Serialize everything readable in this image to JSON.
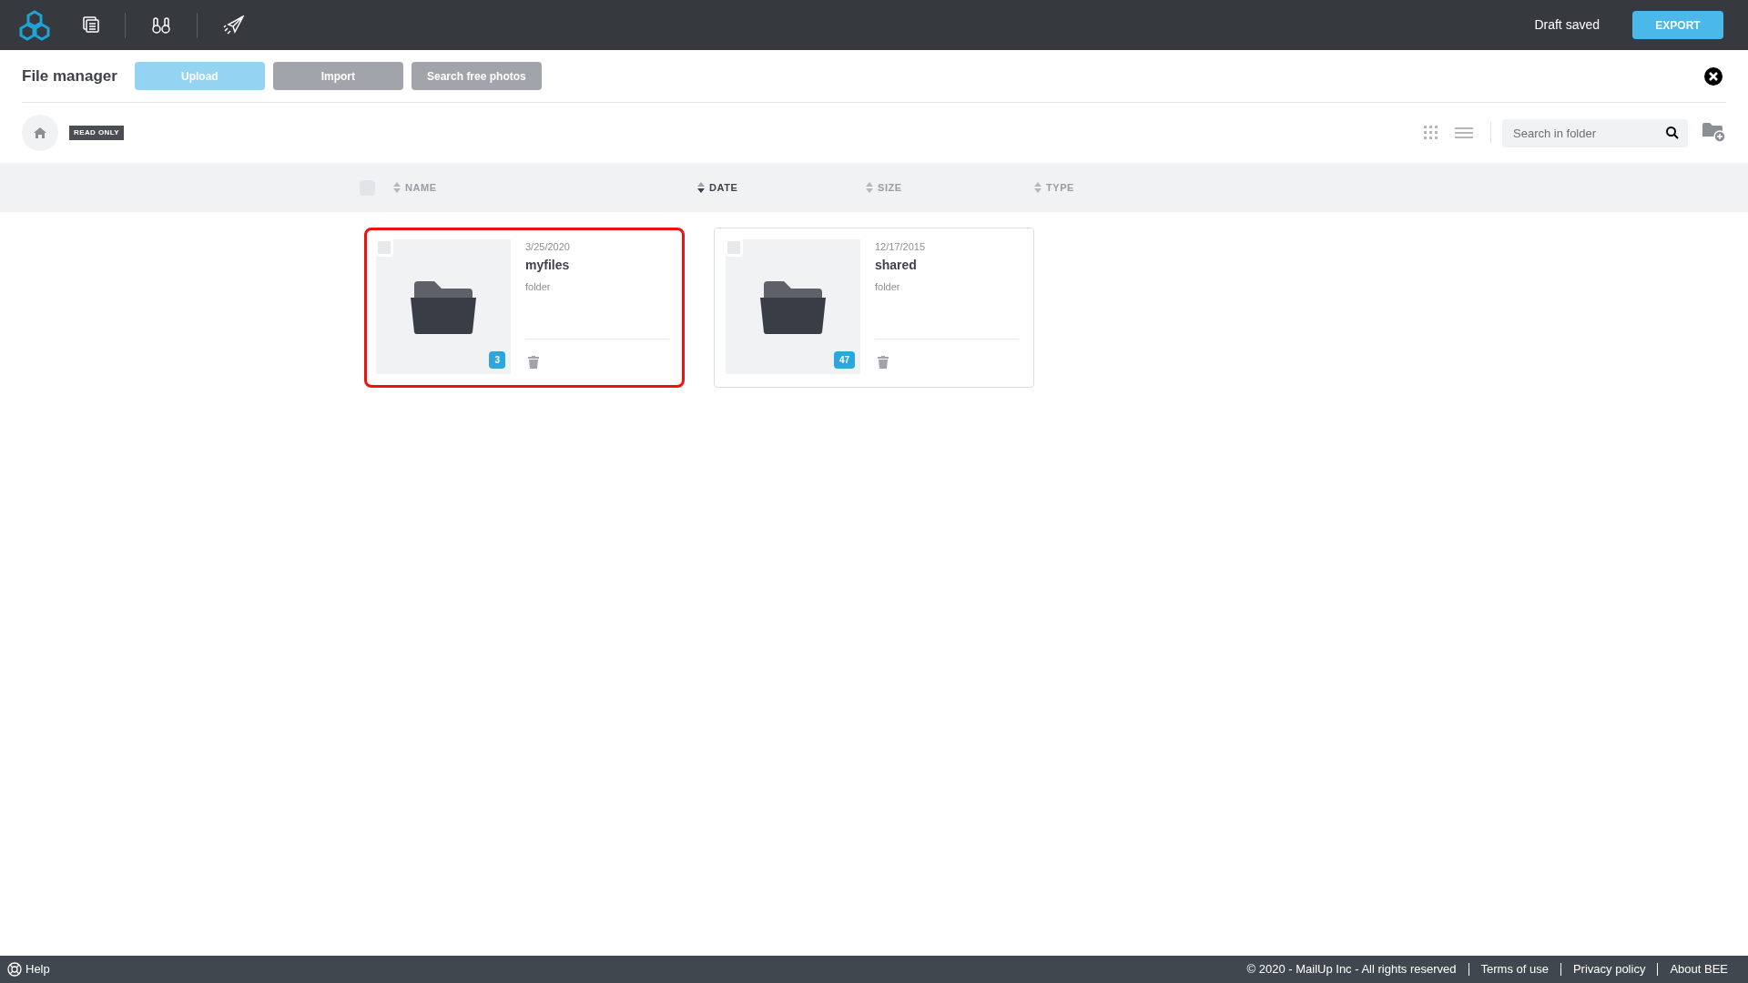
{
  "topbar": {
    "status": "Draft saved",
    "export_button": "EXPORT"
  },
  "file_manager": {
    "title": "File manager",
    "buttons": [
      {
        "label": "Upload",
        "kind": "primary"
      },
      {
        "label": "Import",
        "kind": "secondary"
      },
      {
        "label": "Search free photos",
        "kind": "secondary"
      }
    ]
  },
  "toolbar": {
    "badge": "READ ONLY",
    "search": {
      "placeholder": "Search in folder"
    }
  },
  "select_all": {
    "checked": false
  },
  "columns": [
    {
      "label": "NAME",
      "active": false
    },
    {
      "label": "DATE",
      "active": true
    },
    {
      "label": "SIZE",
      "active": false
    },
    {
      "label": "TYPE",
      "active": false
    }
  ],
  "items": [
    {
      "date": "3/25/2020",
      "name": "myfiles",
      "type": "folder",
      "count": "3",
      "selected": true
    },
    {
      "date": "12/17/2015",
      "name": "shared",
      "type": "folder",
      "count": "47",
      "selected": false
    }
  ],
  "footer": {
    "help": "Help",
    "copyright": "© 2020 - MailUp Inc - All rights reserved",
    "links": [
      "Terms of use",
      "Privacy policy",
      "About BEE"
    ]
  }
}
